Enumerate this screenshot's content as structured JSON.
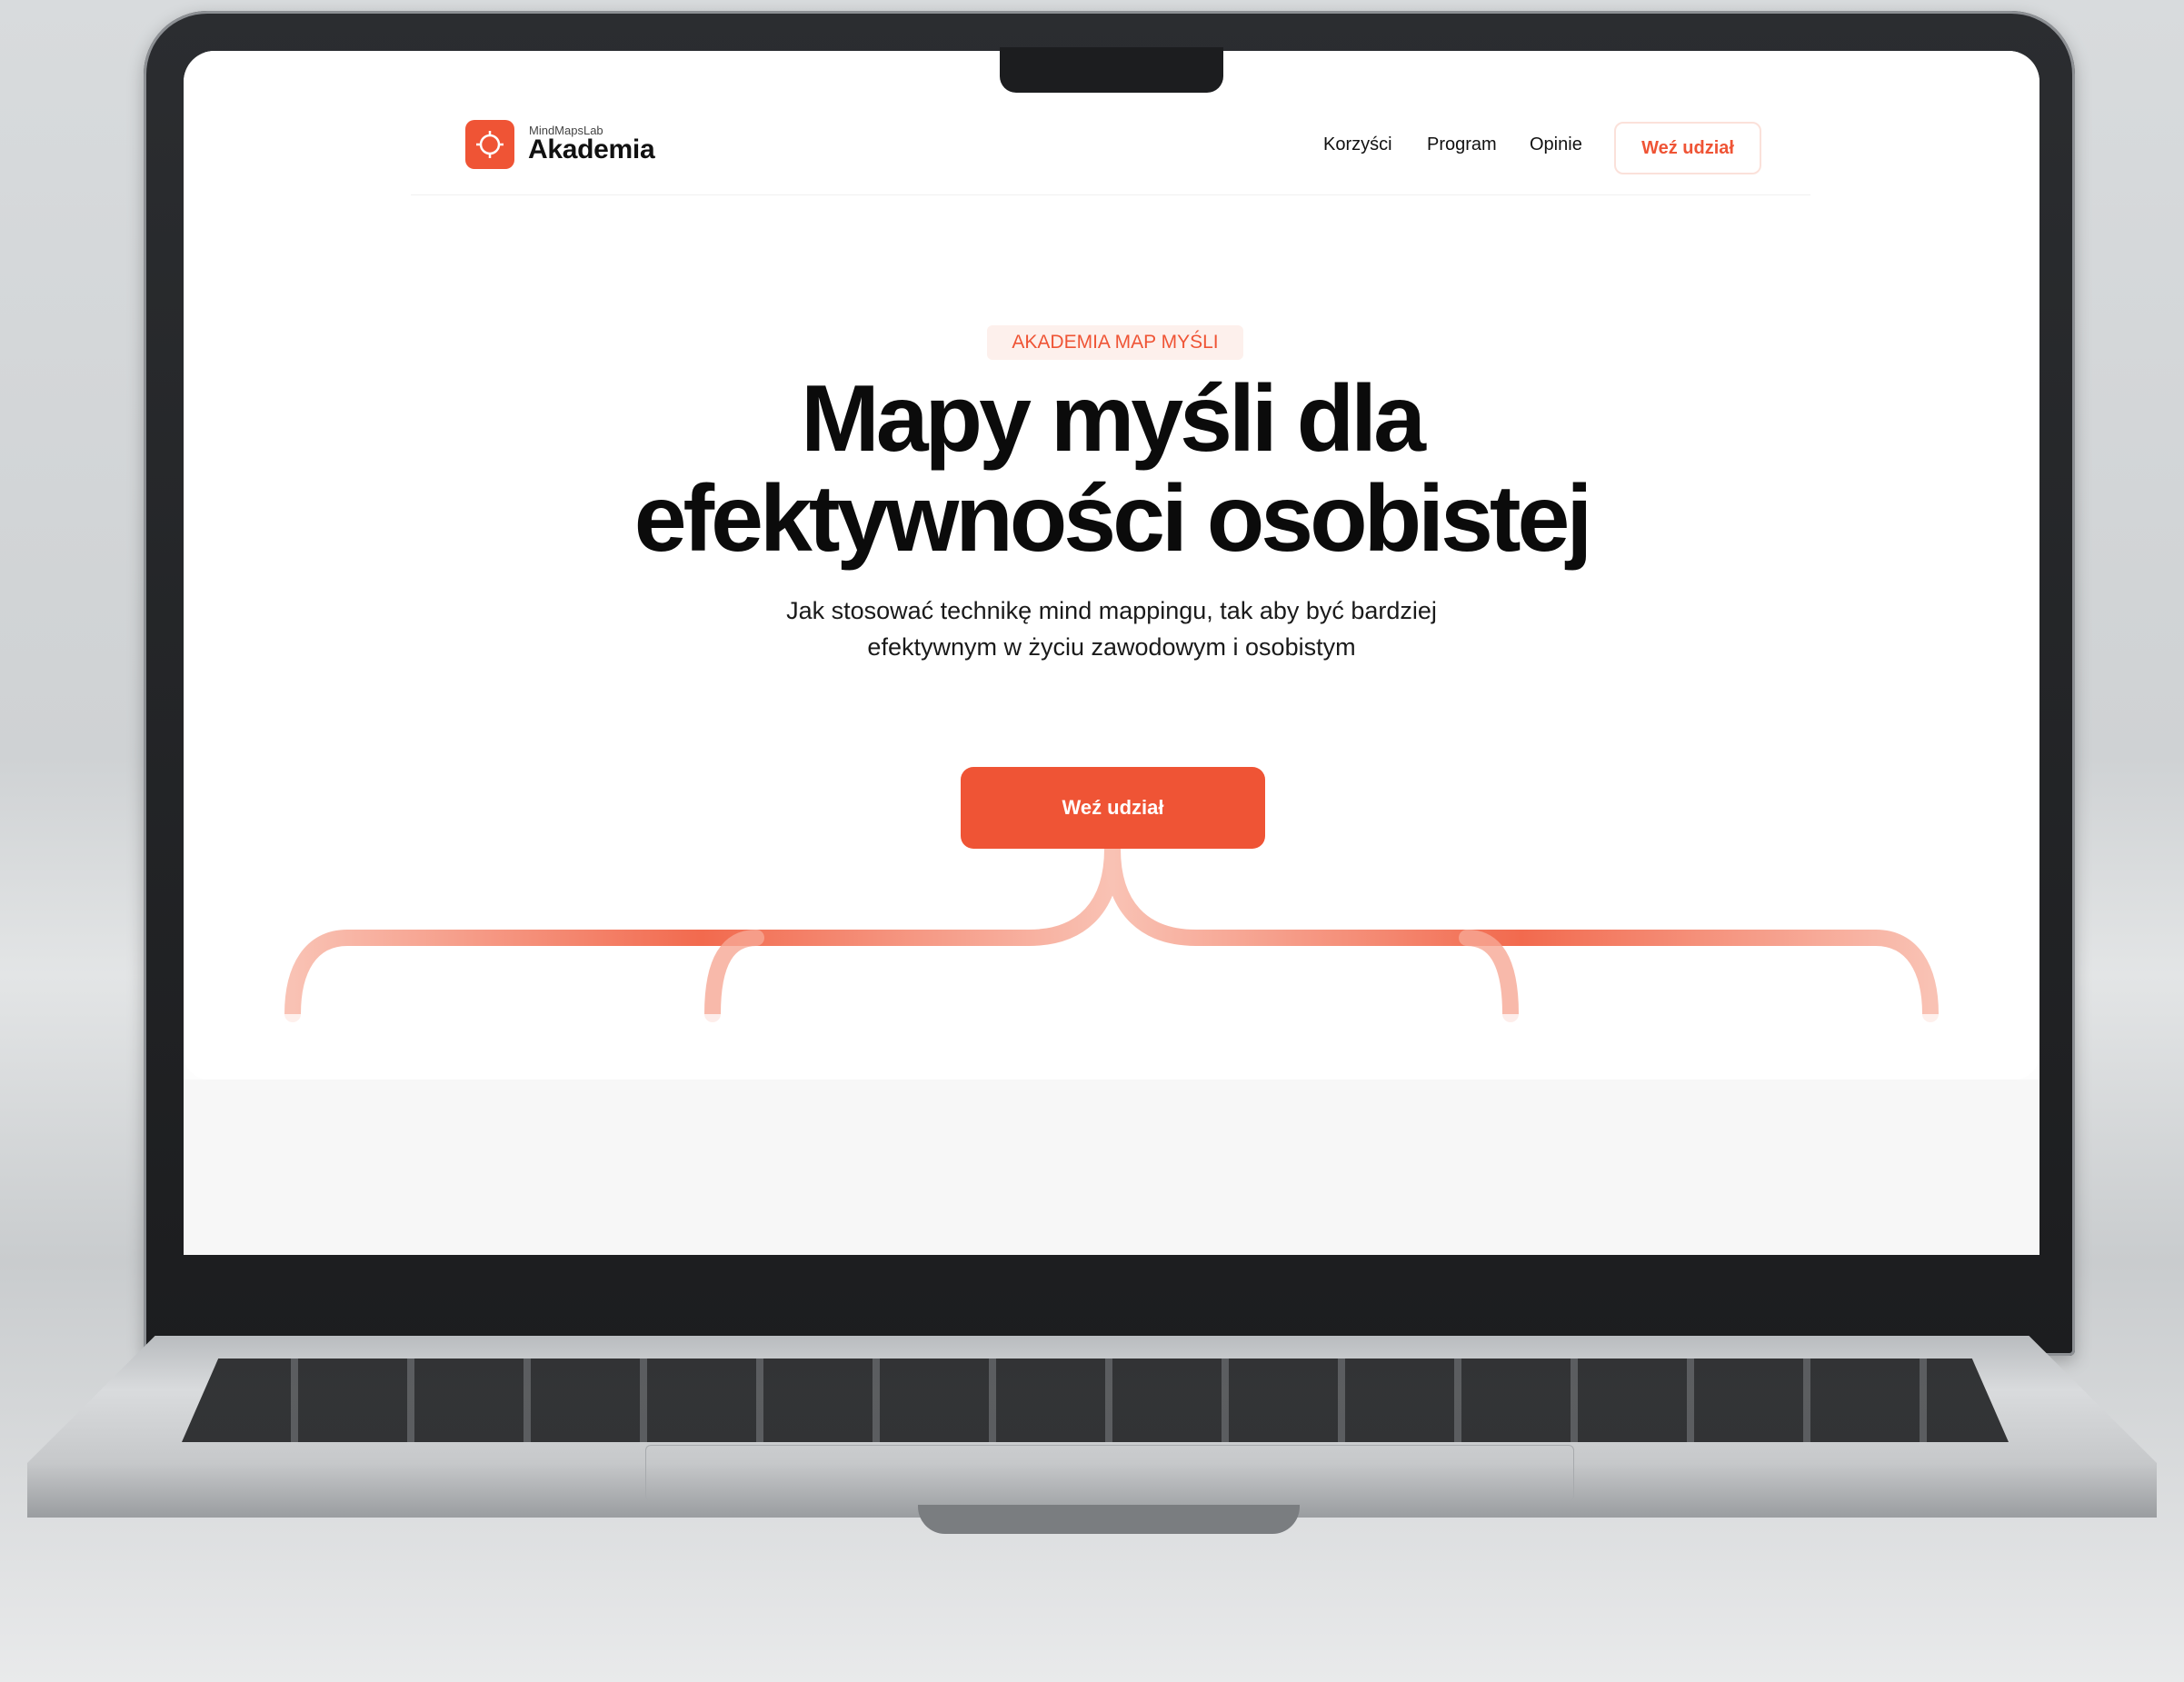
{
  "header": {
    "logo_small": "MindMapsLab",
    "logo_name": "Akademia",
    "nav": [
      "Korzyści",
      "Program",
      "Opinie"
    ],
    "cta_label": "Weź udział"
  },
  "hero": {
    "badge": "AKADEMIA MAP MYŚLI",
    "headline_line1": "Mapy myśli dla",
    "headline_line2": "efektywności osobistej",
    "subtitle_line1": "Jak stosować technikę mind mappingu, tak aby być bardziej",
    "subtitle_line2": "efektywnym w życiu zawodowym i osobistym",
    "cta_label": "Weź udział"
  },
  "colors": {
    "accent": "#ef5435",
    "badge_bg": "#fdf0ec",
    "text": "#0b0b0b"
  },
  "icons": {
    "logo": "compass-icon"
  }
}
